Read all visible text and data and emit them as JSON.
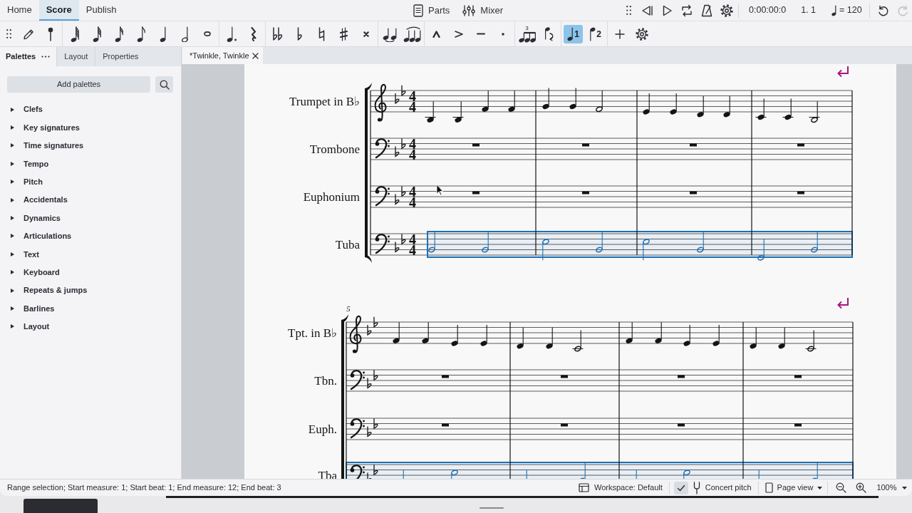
{
  "menu": {
    "tabs": [
      {
        "label": "Home",
        "selected": false
      },
      {
        "label": "Score",
        "selected": true
      },
      {
        "label": "Publish",
        "selected": false
      }
    ],
    "parts_button": "Parts",
    "mixer_button": "Mixer"
  },
  "playback": {
    "time": "0:00:00:0",
    "position": "1. 1",
    "tempo": "= 120",
    "undo": {
      "disabled": false
    },
    "redo": {
      "disabled": true
    }
  },
  "note_input_toolbar": {
    "tuplet_label": "3",
    "voices": [
      {
        "label": "1",
        "selected": true
      },
      {
        "label": "2",
        "selected": false
      }
    ]
  },
  "palettes_panel": {
    "tabs": [
      {
        "label": "Palettes",
        "selected": true
      },
      {
        "label": "Layout",
        "selected": false
      },
      {
        "label": "Properties",
        "selected": false
      }
    ],
    "add_button": "Add palettes",
    "items": [
      {
        "label": "Clefs",
        "expanded": false
      },
      {
        "label": "Key signatures",
        "expanded": false
      },
      {
        "label": "Time signatures",
        "expanded": false
      },
      {
        "label": "Tempo",
        "expanded": false
      },
      {
        "label": "Pitch",
        "expanded": false
      },
      {
        "label": "Accidentals",
        "expanded": false
      },
      {
        "label": "Dynamics",
        "expanded": false
      },
      {
        "label": "Articulations",
        "expanded": false
      },
      {
        "label": "Text",
        "expanded": false
      },
      {
        "label": "Keyboard",
        "expanded": false
      },
      {
        "label": "Repeats & jumps",
        "expanded": false
      },
      {
        "label": "Barlines",
        "expanded": false
      },
      {
        "label": "Layout",
        "expanded": false
      }
    ]
  },
  "document_tabs": [
    {
      "label": "*Twinkle, Twinkle",
      "selected": true
    }
  ],
  "score": {
    "systems": [
      {
        "staves": [
          {
            "name": "Trumpet in B♭",
            "kind": "treble",
            "time_signature": {
              "numerator": "4",
              "denominator": "4"
            },
            "selected": false
          },
          {
            "name": "Trombone",
            "kind": "bass",
            "time_signature": {
              "numerator": "4",
              "denominator": "4"
            },
            "selected": false
          },
          {
            "name": "Euphonium",
            "kind": "bass",
            "time_signature": {
              "numerator": "4",
              "denominator": "4"
            },
            "selected": false
          },
          {
            "name": "Tuba",
            "kind": "bass",
            "time_signature": {
              "numerator": "4",
              "denominator": "4"
            },
            "selected": true
          }
        ]
      },
      {
        "measure_number": "5",
        "staves": [
          {
            "name": "Tpt. in B♭",
            "kind": "treble",
            "selected": false
          },
          {
            "name": "Tbn.",
            "kind": "bass",
            "selected": false
          },
          {
            "name": "Euph.",
            "kind": "bass",
            "selected": false
          },
          {
            "name": "Tba",
            "kind": "bass",
            "selected": true
          }
        ]
      }
    ]
  },
  "status_bar": {
    "message": "Range selection; Start measure: 1; Start beat: 1; End measure: 12; End beat: 3",
    "workspace": "Workspace: Default",
    "concert_pitch": {
      "label": "Concert pitch",
      "checked": true
    },
    "view": "Page view",
    "zoom": "100%"
  }
}
